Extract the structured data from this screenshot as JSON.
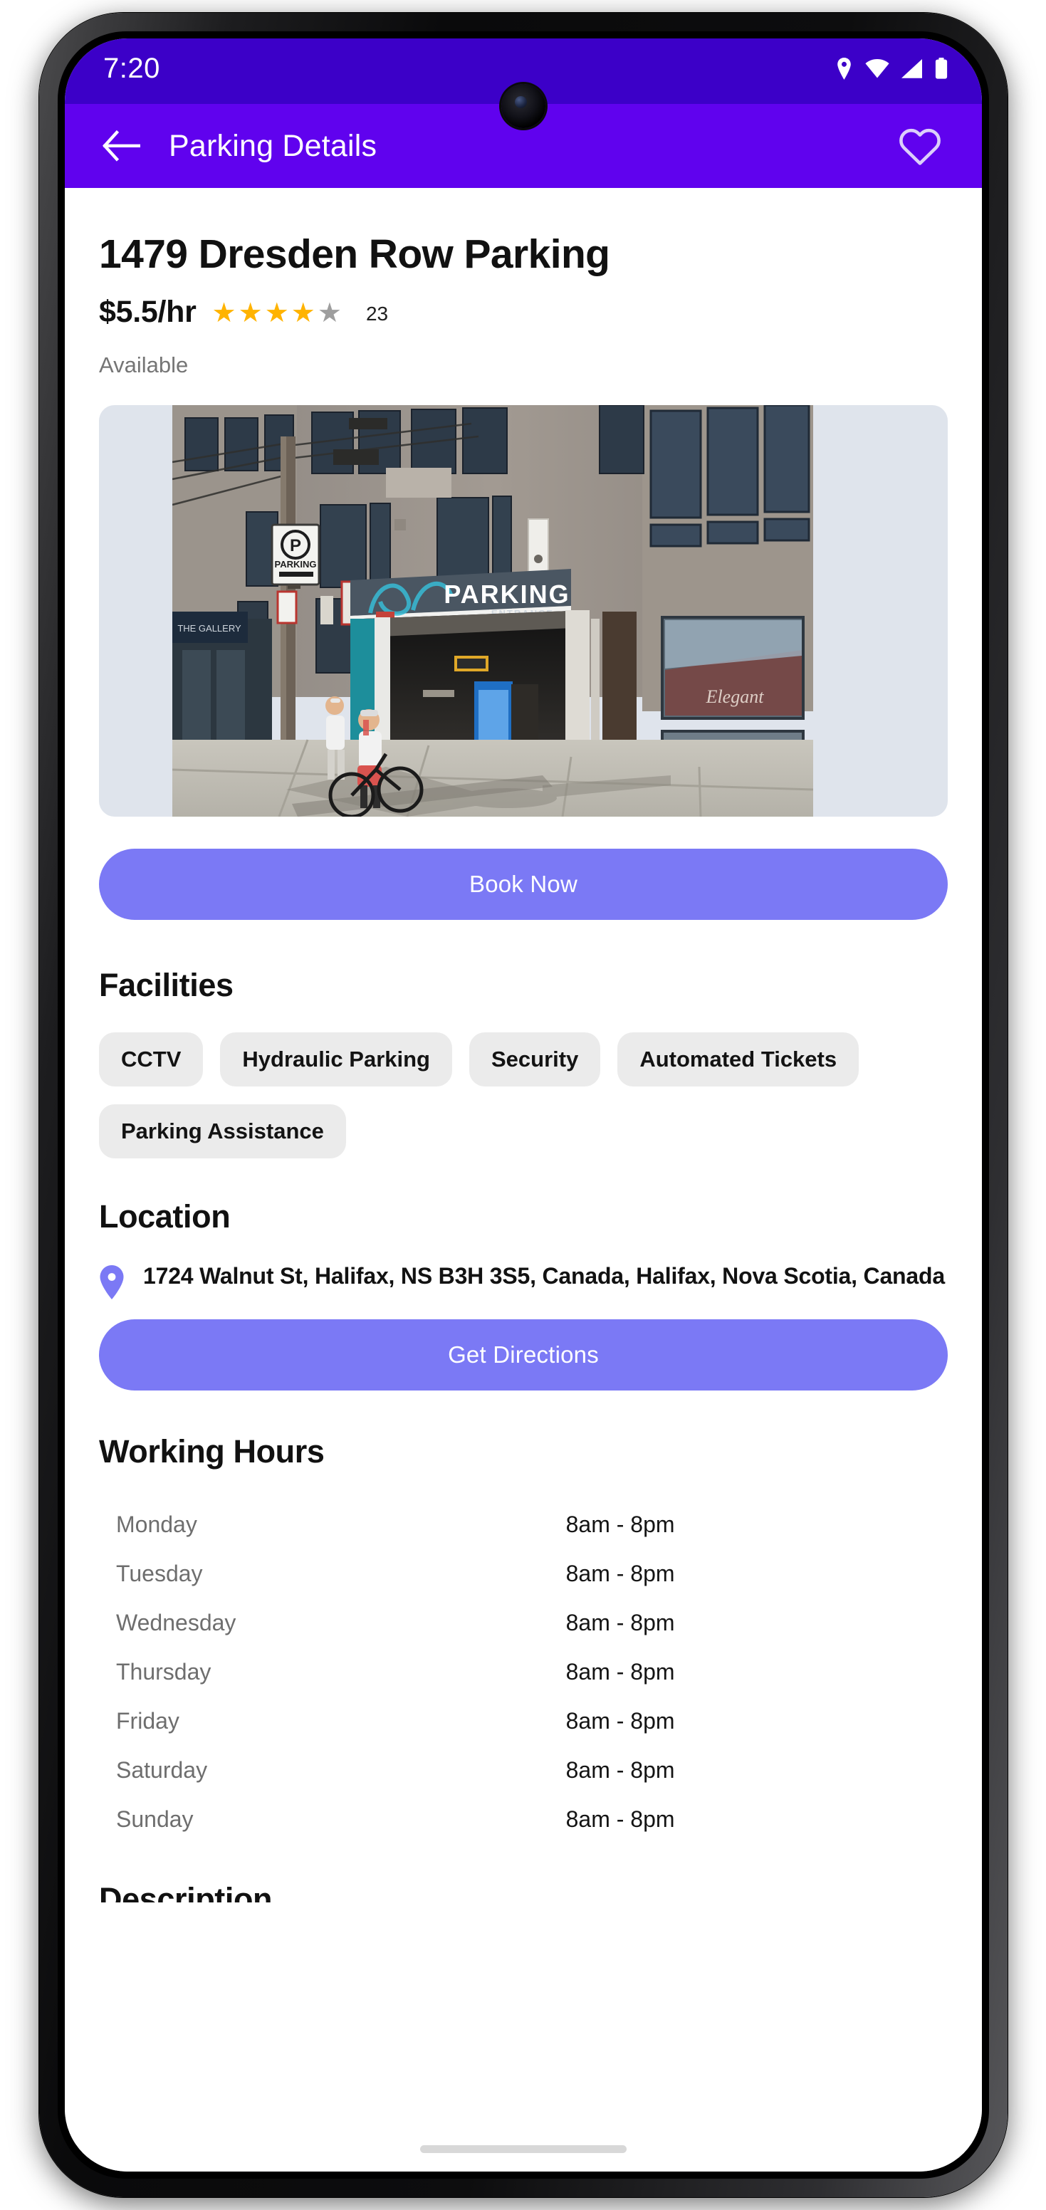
{
  "status_bar": {
    "time": "7:20",
    "icons": [
      "location-pin-icon",
      "wifi-icon",
      "cellular-signal-icon",
      "battery-icon"
    ]
  },
  "app_bar": {
    "back_icon": "back-arrow-icon",
    "title": "Parking Details",
    "favorite_icon": "heart-outline-icon"
  },
  "listing": {
    "title": "1479 Dresden Row Parking",
    "price": "$5.5/hr",
    "rating_filled": 4,
    "rating_total": 5,
    "review_count": "23",
    "availability": "Available",
    "hero_image_alt": "parking-garage-entrance-street-view"
  },
  "actions": {
    "book_now": "Book Now",
    "get_directions": "Get Directions"
  },
  "facilities": {
    "heading": "Facilities",
    "items": [
      "CCTV",
      "Hydraulic Parking",
      "Security",
      "Automated Tickets",
      "Parking Assistance"
    ]
  },
  "location": {
    "heading": "Location",
    "pin_icon": "map-pin-icon",
    "address": "1724 Walnut St, Halifax, NS B3H 3S5, Canada, Halifax, Nova Scotia, Canada"
  },
  "working_hours": {
    "heading": "Working Hours",
    "rows": [
      {
        "day": "Monday",
        "hours": "8am - 8pm"
      },
      {
        "day": "Tuesday",
        "hours": "8am - 8pm"
      },
      {
        "day": "Wednesday",
        "hours": "8am - 8pm"
      },
      {
        "day": "Thursday",
        "hours": "8am - 8pm"
      },
      {
        "day": "Friday",
        "hours": "8am - 8pm"
      },
      {
        "day": "Saturday",
        "hours": "8am - 8pm"
      },
      {
        "day": "Sunday",
        "hours": "8am - 8pm"
      }
    ]
  },
  "next_section": {
    "heading_partial": "Description"
  },
  "colors": {
    "status_bar": "#3c00c8",
    "app_bar": "#6002ee",
    "primary_button": "#7B79F5",
    "chip_background": "#ebebeb",
    "star_filled": "#FFB300",
    "star_empty": "#9e9e9e",
    "muted_text": "#757575"
  }
}
